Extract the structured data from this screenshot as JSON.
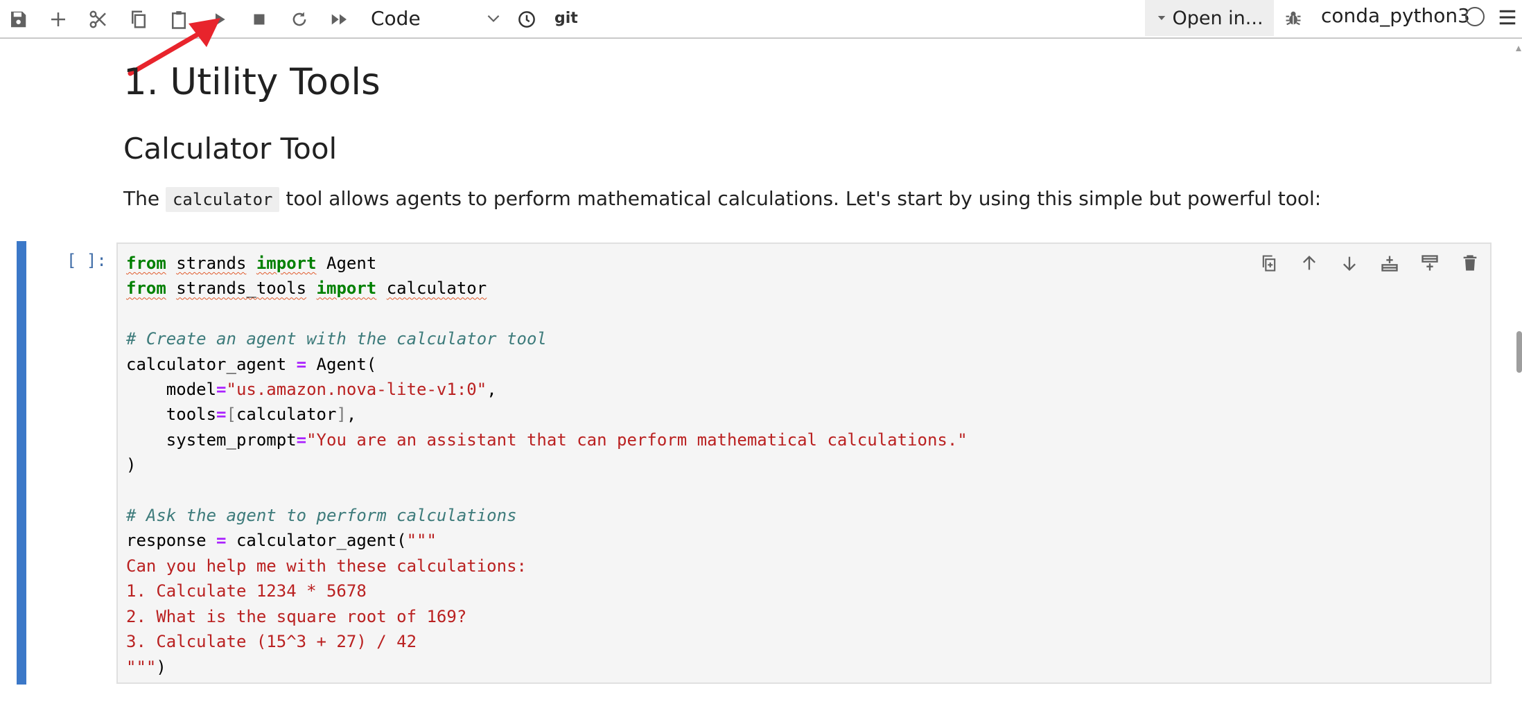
{
  "toolbar": {
    "cell_type": "Code",
    "git_label": "git",
    "open_in_label": "Open in...",
    "kernel_name": "conda_python3",
    "icons": [
      "save-icon",
      "add-icon",
      "cut-icon",
      "copy-icon",
      "paste-icon",
      "run-icon",
      "stop-icon",
      "restart-icon",
      "fast-forward-icon",
      "clock-icon",
      "bug-icon",
      "menu-icon"
    ]
  },
  "markdown": {
    "h1": "1. Utility Tools",
    "h2": "Calculator Tool",
    "p_before": "The ",
    "p_code": "calculator",
    "p_after": " tool allows agents to perform mathematical calculations. Let's start by using this simple but powerful tool:"
  },
  "cell": {
    "prompt": "[ ]:",
    "code": {
      "l1_kw1": "from",
      "l1_mod": "strands",
      "l1_kw2": "import",
      "l1_name": "Agent",
      "l2_kw1": "from",
      "l2_mod": "strands_tools",
      "l2_kw2": "import",
      "l2_name": "calculator",
      "l4_comment": "# Create an agent with the calculator tool",
      "l5_var": "calculator_agent",
      "l5_eq": "=",
      "l5_call": "Agent(",
      "l6_key": "model",
      "l6_eq": "=",
      "l6_str": "\"us.amazon.nova-lite-v1:0\"",
      "l6_comma": ",",
      "l7_key": "tools",
      "l7_eq": "=",
      "l7_open": "[",
      "l7_val": "calculator",
      "l7_close": "]",
      "l7_comma": ",",
      "l8_key": "system_prompt",
      "l8_eq": "=",
      "l8_str": "\"You are an assistant that can perform mathematical calculations.\"",
      "l9": ")",
      "l11_comment": "# Ask the agent to perform calculations",
      "l12_var": "response",
      "l12_eq": "=",
      "l12_call": "calculator_agent(",
      "l12_str": "\"\"\"",
      "l13": "Can you help me with these calculations:",
      "l14": "1. Calculate 1234 * 5678",
      "l15": "2. What is the square root of 169?",
      "l16": "3. Calculate (15^3 + 27) / 42",
      "l17_str": "\"\"\"",
      "l17_close": ")"
    },
    "action_icons": [
      "duplicate-icon",
      "move-up-icon",
      "move-down-icon",
      "insert-above-icon",
      "insert-below-icon",
      "delete-icon"
    ]
  },
  "colors": {
    "accent": "#3b78c8",
    "keyword": "#008000",
    "operator": "#aa22ff",
    "string": "#ba2121",
    "comment": "#3d7b7b",
    "annotation_arrow": "#e8242c"
  }
}
